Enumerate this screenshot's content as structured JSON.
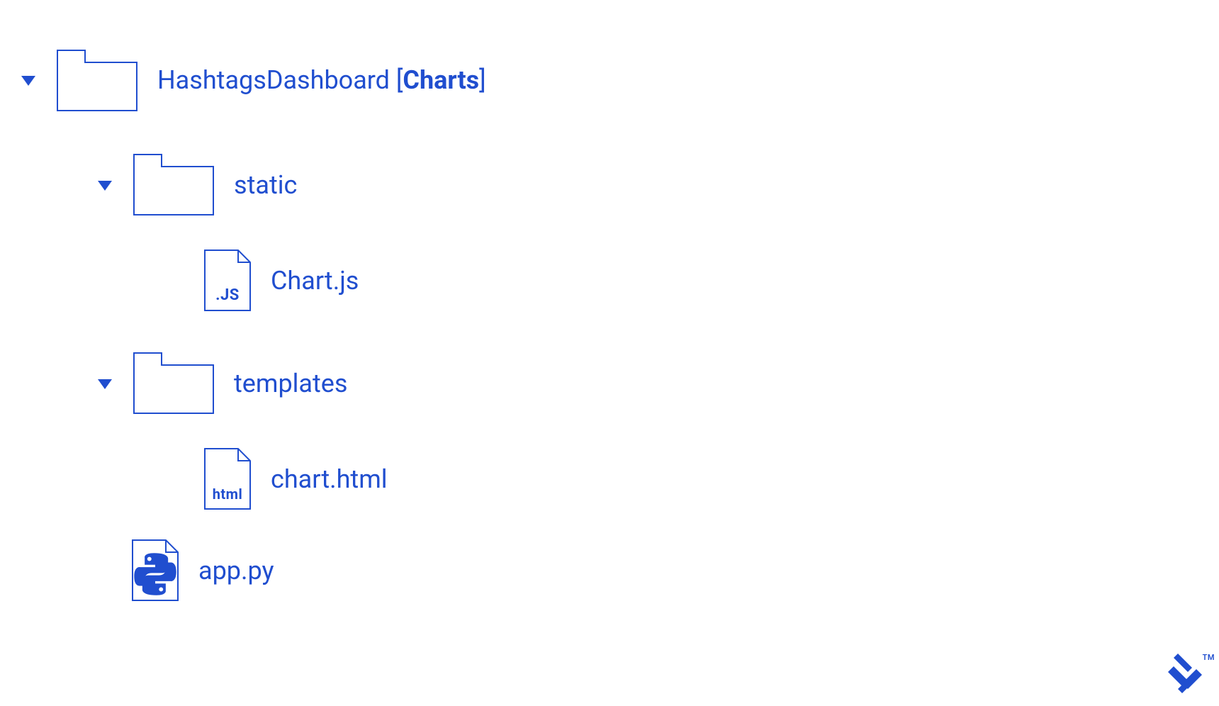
{
  "colors": {
    "primary": "#204ecf"
  },
  "tree": {
    "root": {
      "name_prefix": "HashtagsDashboard [",
      "name_strong": "Charts",
      "name_suffix": "]"
    },
    "folders": {
      "static": {
        "label": "static"
      },
      "templates": {
        "label": "templates"
      }
    },
    "files": {
      "chart_js": {
        "label": "Chart.js",
        "ext": ".JS"
      },
      "chart_html": {
        "label": "chart.html",
        "ext": "html"
      },
      "app_py": {
        "label": "app.py"
      }
    }
  },
  "brand": {
    "trademark": "TM"
  }
}
